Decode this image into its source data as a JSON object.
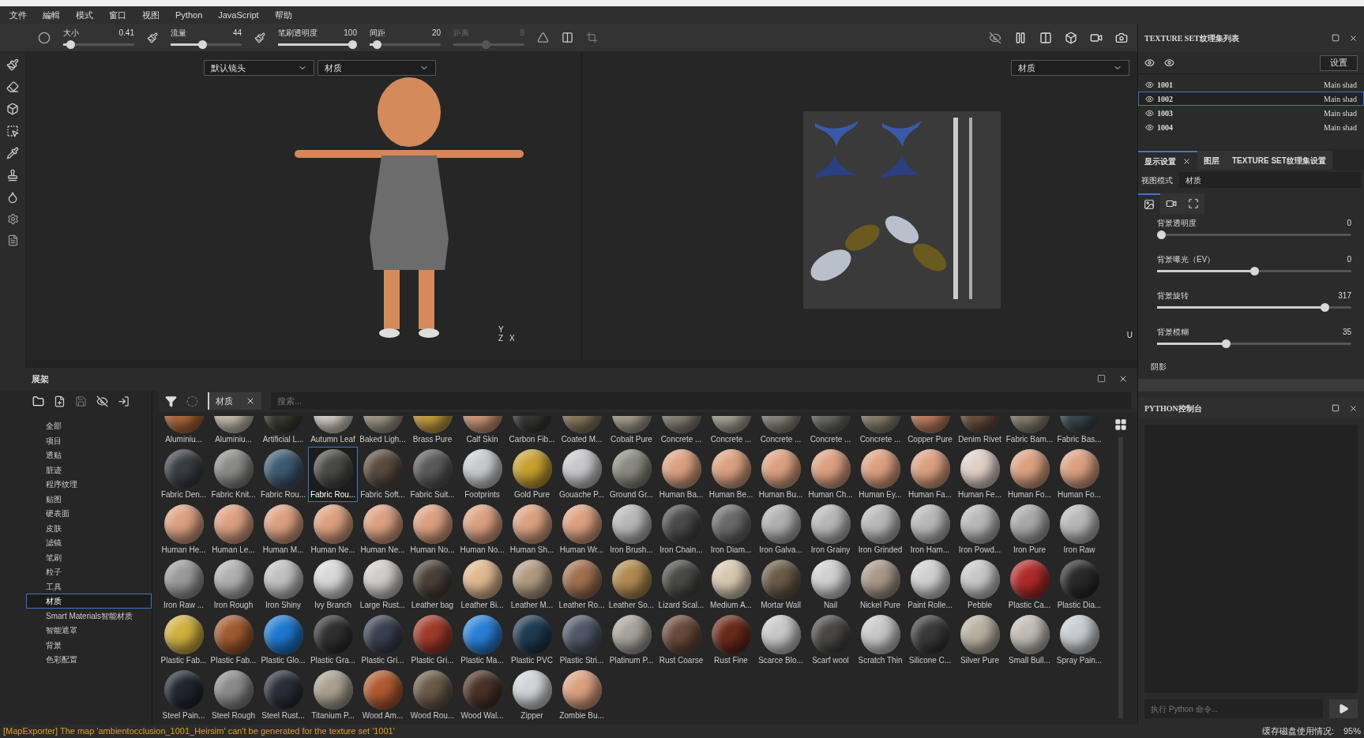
{
  "menu": [
    {
      "label": "文件"
    },
    {
      "label": "編輯"
    },
    {
      "label": "模式"
    },
    {
      "label": "窗口"
    },
    {
      "label": "视图"
    },
    {
      "label": "Python"
    },
    {
      "label": "JavaScript"
    },
    {
      "label": "帮助"
    }
  ],
  "toolbar": {
    "sliders": [
      {
        "label": "大小",
        "reading": "0.41",
        "level": 0.05,
        "disabled": false
      },
      {
        "label": "流量",
        "reading": "44",
        "level": 0.44,
        "disabled": false
      },
      {
        "label": "笔刷透明度",
        "reading": "100",
        "level": 1,
        "disabled": false
      },
      {
        "label": "间距",
        "reading": "20",
        "level": 0.05,
        "disabled": false
      },
      {
        "label": "距离",
        "reading": "8",
        "level": 0.45,
        "disabled": true
      }
    ]
  },
  "viewport": {
    "camera_dropdown": "默认镜头",
    "left_mode_dropdown": "材质",
    "right_mode_dropdown": "材质",
    "left_axes": [
      "Y",
      "Z",
      "X"
    ],
    "right_axes": [
      "U"
    ]
  },
  "texture_sets": {
    "title": "TEXTURE SET纹理集列表",
    "settings_button": "设置",
    "items": [
      {
        "name": "1001",
        "shader": "Main shad",
        "selected": false
      },
      {
        "name": "1002",
        "shader": "Main shad",
        "selected": true
      },
      {
        "name": "1003",
        "shader": "Main shad",
        "selected": false
      },
      {
        "name": "1004",
        "shader": "Main shad",
        "selected": false
      }
    ]
  },
  "display_settings": {
    "tabs": [
      {
        "label": "显示设置",
        "selected": true,
        "closable": true
      },
      {
        "label": "图层",
        "selected": false,
        "closable": false
      },
      {
        "label": "TEXTURE SET纹理集设置",
        "selected": false,
        "closable": false
      }
    ],
    "view_mode_label": "视图模式",
    "view_mode": "材质",
    "icon_tabs": [
      {
        "kind": "image",
        "selected": true
      },
      {
        "kind": "camera",
        "selected": false
      },
      {
        "kind": "frame",
        "selected": false
      }
    ],
    "sliders": [
      {
        "label": "背景透明度",
        "reading": "0",
        "level": 0
      },
      {
        "label": "背景曝光（EV）",
        "reading": "0",
        "level": 0.5
      },
      {
        "label": "背景旋转",
        "reading": "317",
        "level": 0.88
      },
      {
        "label": "背景模糊",
        "reading": "35",
        "level": 0.35
      }
    ],
    "section": "阴影"
  },
  "shelf": {
    "title": "展架",
    "categories": [
      {
        "label": "全部",
        "selected": false
      },
      {
        "label": "项目",
        "selected": false
      },
      {
        "label": "透贴",
        "selected": false
      },
      {
        "label": "脏迹",
        "selected": false
      },
      {
        "label": "程序纹理",
        "selected": false
      },
      {
        "label": "贴图",
        "selected": false
      },
      {
        "label": "硬表面",
        "selected": false
      },
      {
        "label": "皮肤",
        "selected": false
      },
      {
        "label": "滤镜",
        "selected": false
      },
      {
        "label": "笔刷",
        "selected": false
      },
      {
        "label": "粒子",
        "selected": false
      },
      {
        "label": "工具",
        "selected": false
      },
      {
        "label": "材质",
        "selected": true
      },
      {
        "label": "Smart Materials智能材质",
        "selected": false
      },
      {
        "label": "智能遮罩",
        "selected": false
      },
      {
        "label": "背景",
        "selected": false
      },
      {
        "label": "色彩配置",
        "selected": false
      }
    ],
    "filter_chip": "材质",
    "search": {
      "placeholder": "搜索..."
    },
    "materials": [
      {
        "name": "Aluminiu...",
        "color": "#b06a3a",
        "selected": false
      },
      {
        "name": "Aluminiu...",
        "color": "#c8c0b0",
        "selected": false
      },
      {
        "name": "Artificial L...",
        "color": "#3a3d30",
        "selected": false
      },
      {
        "name": "Autumn Leaf",
        "color": "#d8d0c8",
        "selected": false
      },
      {
        "name": "Baked Ligh...",
        "color": "#a09888",
        "selected": false
      },
      {
        "name": "Brass Pure",
        "color": "#c8a040",
        "selected": false
      },
      {
        "name": "Calf Skin",
        "color": "#d09a7a",
        "selected": false
      },
      {
        "name": "Carbon Fib...",
        "color": "#3a3a38",
        "selected": false
      },
      {
        "name": "Coated M...",
        "color": "#8a7a60",
        "selected": false
      },
      {
        "name": "Cobalt Pure",
        "color": "#a8a090",
        "selected": false
      },
      {
        "name": "Concrete ...",
        "color": "#8a8478",
        "selected": false
      },
      {
        "name": "Concrete ...",
        "color": "#a8a498",
        "selected": false
      },
      {
        "name": "Concrete ...",
        "color": "#8a887e",
        "selected": false
      },
      {
        "name": "Concrete ...",
        "color": "#6a6a66",
        "selected": false
      },
      {
        "name": "Concrete ...",
        "color": "#8a8070",
        "selected": false
      },
      {
        "name": "Copper Pure",
        "color": "#c08060",
        "selected": false
      },
      {
        "name": "Denim Rivet",
        "color": "#6a5040",
        "selected": false
      },
      {
        "name": "Fabric Bam...",
        "color": "#8a8270",
        "selected": false
      },
      {
        "name": "Fabric Bas...",
        "color": "#3a4a50",
        "selected": false
      },
      {
        "name": "Fabric Den...",
        "color": "#3a3e44",
        "selected": false
      },
      {
        "name": "Fabric Knit...",
        "color": "#8a8a88",
        "selected": false
      },
      {
        "name": "Fabric Rou...",
        "color": "#3e5a72",
        "selected": false
      },
      {
        "name": "Fabric Rou...",
        "color": "#4a4a48",
        "selected": true
      },
      {
        "name": "Fabric Soft...",
        "color": "#5a4a3e",
        "selected": false
      },
      {
        "name": "Fabric Suit...",
        "color": "#5a5a5c",
        "selected": false
      },
      {
        "name": "Footprints",
        "color": "#c8ccd0",
        "selected": false
      },
      {
        "name": "Gold Pure",
        "color": "#c8a030",
        "selected": false
      },
      {
        "name": "Gouache P...",
        "color": "#c8c8cc",
        "selected": false
      },
      {
        "name": "Ground Gr...",
        "color": "#8a8a80",
        "selected": false
      },
      {
        "name": "Human Ba...",
        "color": "#dca080",
        "selected": false
      },
      {
        "name": "Human Be...",
        "color": "#dca080",
        "selected": false
      },
      {
        "name": "Human Bu...",
        "color": "#dca080",
        "selected": false
      },
      {
        "name": "Human Ch...",
        "color": "#dca080",
        "selected": false
      },
      {
        "name": "Human Ey...",
        "color": "#dca080",
        "selected": false
      },
      {
        "name": "Human Fa...",
        "color": "#dca080",
        "selected": false
      },
      {
        "name": "Human Fe...",
        "color": "#e0d0c8",
        "selected": false
      },
      {
        "name": "Human Fo...",
        "color": "#dca080",
        "selected": false
      },
      {
        "name": "Human Fo...",
        "color": "#dca080",
        "selected": false
      },
      {
        "name": "Human He...",
        "color": "#dca080",
        "selected": false
      },
      {
        "name": "Human Le...",
        "color": "#dca080",
        "selected": false
      },
      {
        "name": "Human M...",
        "color": "#dca080",
        "selected": false
      },
      {
        "name": "Human Ne...",
        "color": "#dca080",
        "selected": false
      },
      {
        "name": "Human Ne...",
        "color": "#dca080",
        "selected": false
      },
      {
        "name": "Human No...",
        "color": "#dca080",
        "selected": false
      },
      {
        "name": "Human No...",
        "color": "#dca080",
        "selected": false
      },
      {
        "name": "Human Sh...",
        "color": "#dca080",
        "selected": false
      },
      {
        "name": "Human Wr...",
        "color": "#dca080",
        "selected": false
      },
      {
        "name": "Iron Brush...",
        "color": "#b8b8b8",
        "selected": false
      },
      {
        "name": "Iron Chain...",
        "color": "#4a4a4a",
        "selected": false
      },
      {
        "name": "Iron Diam...",
        "color": "#6a6a6a",
        "selected": false
      },
      {
        "name": "Iron Galva...",
        "color": "#b0b0b0",
        "selected": false
      },
      {
        "name": "Iron Grainy",
        "color": "#b8b8b8",
        "selected": false
      },
      {
        "name": "Iron Grinded",
        "color": "#b8b8b8",
        "selected": false
      },
      {
        "name": "Iron Ham...",
        "color": "#b8b8b8",
        "selected": false
      },
      {
        "name": "Iron Powd...",
        "color": "#b8b8b8",
        "selected": false
      },
      {
        "name": "Iron Pure",
        "color": "#a8a8a8",
        "selected": false
      },
      {
        "name": "Iron Raw",
        "color": "#b8b8b8",
        "selected": false
      },
      {
        "name": "Iron Raw ...",
        "color": "#9a9a9a",
        "selected": false
      },
      {
        "name": "Iron Rough",
        "color": "#b0b0b0",
        "selected": false
      },
      {
        "name": "Iron Shiny",
        "color": "#c0c0c0",
        "selected": false
      },
      {
        "name": "Ivy Branch",
        "color": "#d8d8d8",
        "selected": false
      },
      {
        "name": "Large Rust...",
        "color": "#d0ccc8",
        "selected": false
      },
      {
        "name": "Leather bag",
        "color": "#4a4038",
        "selected": false
      },
      {
        "name": "Leather Bi...",
        "color": "#e0b890",
        "selected": false
      },
      {
        "name": "Leather M...",
        "color": "#b09a80",
        "selected": false
      },
      {
        "name": "Leather Ro...",
        "color": "#a07050",
        "selected": false
      },
      {
        "name": "Leather So...",
        "color": "#b08a50",
        "selected": false
      },
      {
        "name": "Lizard Scal...",
        "color": "#4a4a46",
        "selected": false
      },
      {
        "name": "Medium A...",
        "color": "#d8c8b0",
        "selected": false
      },
      {
        "name": "Mortar Wall",
        "color": "#6a5a48",
        "selected": false
      },
      {
        "name": "Nail",
        "color": "#d0d0d0",
        "selected": false
      },
      {
        "name": "Nickel Pure",
        "color": "#a89888",
        "selected": false
      },
      {
        "name": "Paint Rolle...",
        "color": "#d0d0d0",
        "selected": false
      },
      {
        "name": "Pebble",
        "color": "#c8c8c8",
        "selected": false
      },
      {
        "name": "Plastic Ca...",
        "color": "#b02a2a",
        "selected": false
      },
      {
        "name": "Plastic Dia...",
        "color": "#2a2a2a",
        "selected": false
      },
      {
        "name": "Plastic Fab...",
        "color": "#d0b040",
        "selected": false
      },
      {
        "name": "Plastic Fab...",
        "color": "#a05a30",
        "selected": false
      },
      {
        "name": "Plastic Glo...",
        "color": "#1e78d0",
        "selected": false
      },
      {
        "name": "Plastic Gra...",
        "color": "#303030",
        "selected": false
      },
      {
        "name": "Plastic Gri...",
        "color": "#3a4050",
        "selected": false
      },
      {
        "name": "Plastic Gri...",
        "color": "#a03a2a",
        "selected": false
      },
      {
        "name": "Plastic Ma...",
        "color": "#2a80d8",
        "selected": false
      },
      {
        "name": "Plastic PVC",
        "color": "#1e3a50",
        "selected": false
      },
      {
        "name": "Plastic Stri...",
        "color": "#505868",
        "selected": false
      },
      {
        "name": "Platinum P...",
        "color": "#a8a49c",
        "selected": false
      },
      {
        "name": "Rust Coarse",
        "color": "#6a4a3a",
        "selected": false
      },
      {
        "name": "Rust Fine",
        "color": "#6a2a1a",
        "selected": false
      },
      {
        "name": "Scarce Blo...",
        "color": "#c8c8c8",
        "selected": false
      },
      {
        "name": "Scarf wool",
        "color": "#4a4844",
        "selected": false
      },
      {
        "name": "Scratch Thin",
        "color": "#c8c8c8",
        "selected": false
      },
      {
        "name": "Silicone C...",
        "color": "#3a3a3a",
        "selected": false
      },
      {
        "name": "Silver Pure",
        "color": "#b8b0a0",
        "selected": false
      },
      {
        "name": "Small Bull...",
        "color": "#c0bcb4",
        "selected": false
      },
      {
        "name": "Spray Pain...",
        "color": "#c8ccd0",
        "selected": false
      },
      {
        "name": "Steel Pain...",
        "color": "#222630",
        "selected": false
      },
      {
        "name": "Steel Rough",
        "color": "#8a8a8a",
        "selected": false
      },
      {
        "name": "Steel Rust...",
        "color": "#2a2e38",
        "selected": false
      },
      {
        "name": "Titanium P...",
        "color": "#a8a090",
        "selected": false
      },
      {
        "name": "Wood Am...",
        "color": "#b05a30",
        "selected": false
      },
      {
        "name": "Wood Rou...",
        "color": "#6a5a48",
        "selected": false
      },
      {
        "name": "Wood Wal...",
        "color": "#4a3228",
        "selected": false
      },
      {
        "name": "Zipper",
        "color": "#d0d4d8",
        "selected": false
      },
      {
        "name": "Zombie Bu...",
        "color": "#dca080",
        "selected": false
      }
    ]
  },
  "python_console": {
    "title": "PYTHON控制台",
    "input": {
      "placeholder": "执行 Python 命令..."
    }
  },
  "status_bar": {
    "message": "[MapExporter] The map 'ambientocclusion_1001_Heirsim' can't be generated for the texture set '1001'",
    "cache_label": "缓存磁盘使用情况:",
    "cache_value": "95%"
  }
}
